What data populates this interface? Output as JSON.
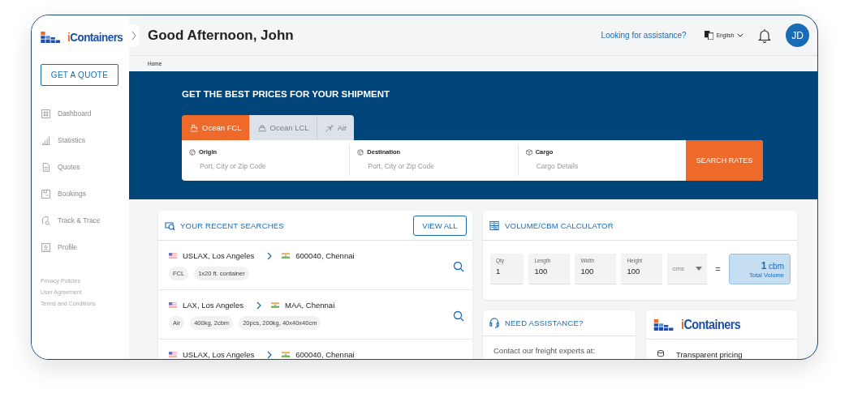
{
  "logo": {
    "text": "iContainers"
  },
  "sidebar": {
    "quote_button": "GET A QUOTE",
    "items": [
      {
        "label": "Dashboard"
      },
      {
        "label": "Statistics"
      },
      {
        "label": "Quotes"
      },
      {
        "label": "Bookings"
      },
      {
        "label": "Track & Trace"
      },
      {
        "label": "Profile"
      }
    ],
    "footer_links": [
      "Privacy Policies",
      "User Agreement",
      "Terms and Conditions"
    ]
  },
  "header": {
    "greeting": "Good Afternoon, John",
    "help_link": "Looking for assistance?",
    "language": "English",
    "avatar": "JD"
  },
  "breadcrumb": [
    "Home"
  ],
  "banner": {
    "title": "GET THE BEST PRICES FOR YOUR SHIPMENT",
    "tabs": [
      {
        "label": "Ocean FCL",
        "selected": true
      },
      {
        "label": "Ocean LCL",
        "selected": false
      },
      {
        "label": "Air",
        "selected": false
      }
    ],
    "fields": [
      {
        "label": "Origin",
        "placeholder": "Port, City or Zip Code"
      },
      {
        "label": "Destination",
        "placeholder": "Port, City or Zip Code"
      },
      {
        "label": "Cargo",
        "placeholder": "Cargo Details"
      }
    ],
    "button": "SEARCH RATES"
  },
  "recent_searches": {
    "title": "YOUR RECENT SEARCHES",
    "button": "VIEW ALL",
    "rows": [
      {
        "origin": "USLAX, Los Angeles",
        "destination": "600040, Chennai",
        "tags": [
          "FCL",
          "1x20 ft. container"
        ]
      },
      {
        "origin": "LAX, Los Angeles",
        "destination": "MAA, Chennai",
        "tags": [
          "Air",
          "400kg, 2cbm",
          "20pcs, 200kg, 40x40x40cm"
        ]
      },
      {
        "origin": "USLAX, Los Angeles",
        "destination": "600040, Chennai"
      }
    ]
  },
  "calculator": {
    "title": "VOLUME/CBM CALCULATOR",
    "fields": [
      {
        "label": "Qty",
        "value": "1"
      },
      {
        "label": "Length",
        "value": "100"
      },
      {
        "label": "Width",
        "value": "100"
      },
      {
        "label": "Height",
        "value": "100"
      }
    ],
    "unit": "cms",
    "equals": "=",
    "result": {
      "value": "1",
      "unit": "cbm",
      "label": "Total Volume"
    }
  },
  "assistance": {
    "title": "NEED ASSISTANCE?",
    "text": "Contact our freight experts at:"
  },
  "brand_card": {
    "logo": "iContainers",
    "features": [
      "Transparent pricing"
    ]
  }
}
